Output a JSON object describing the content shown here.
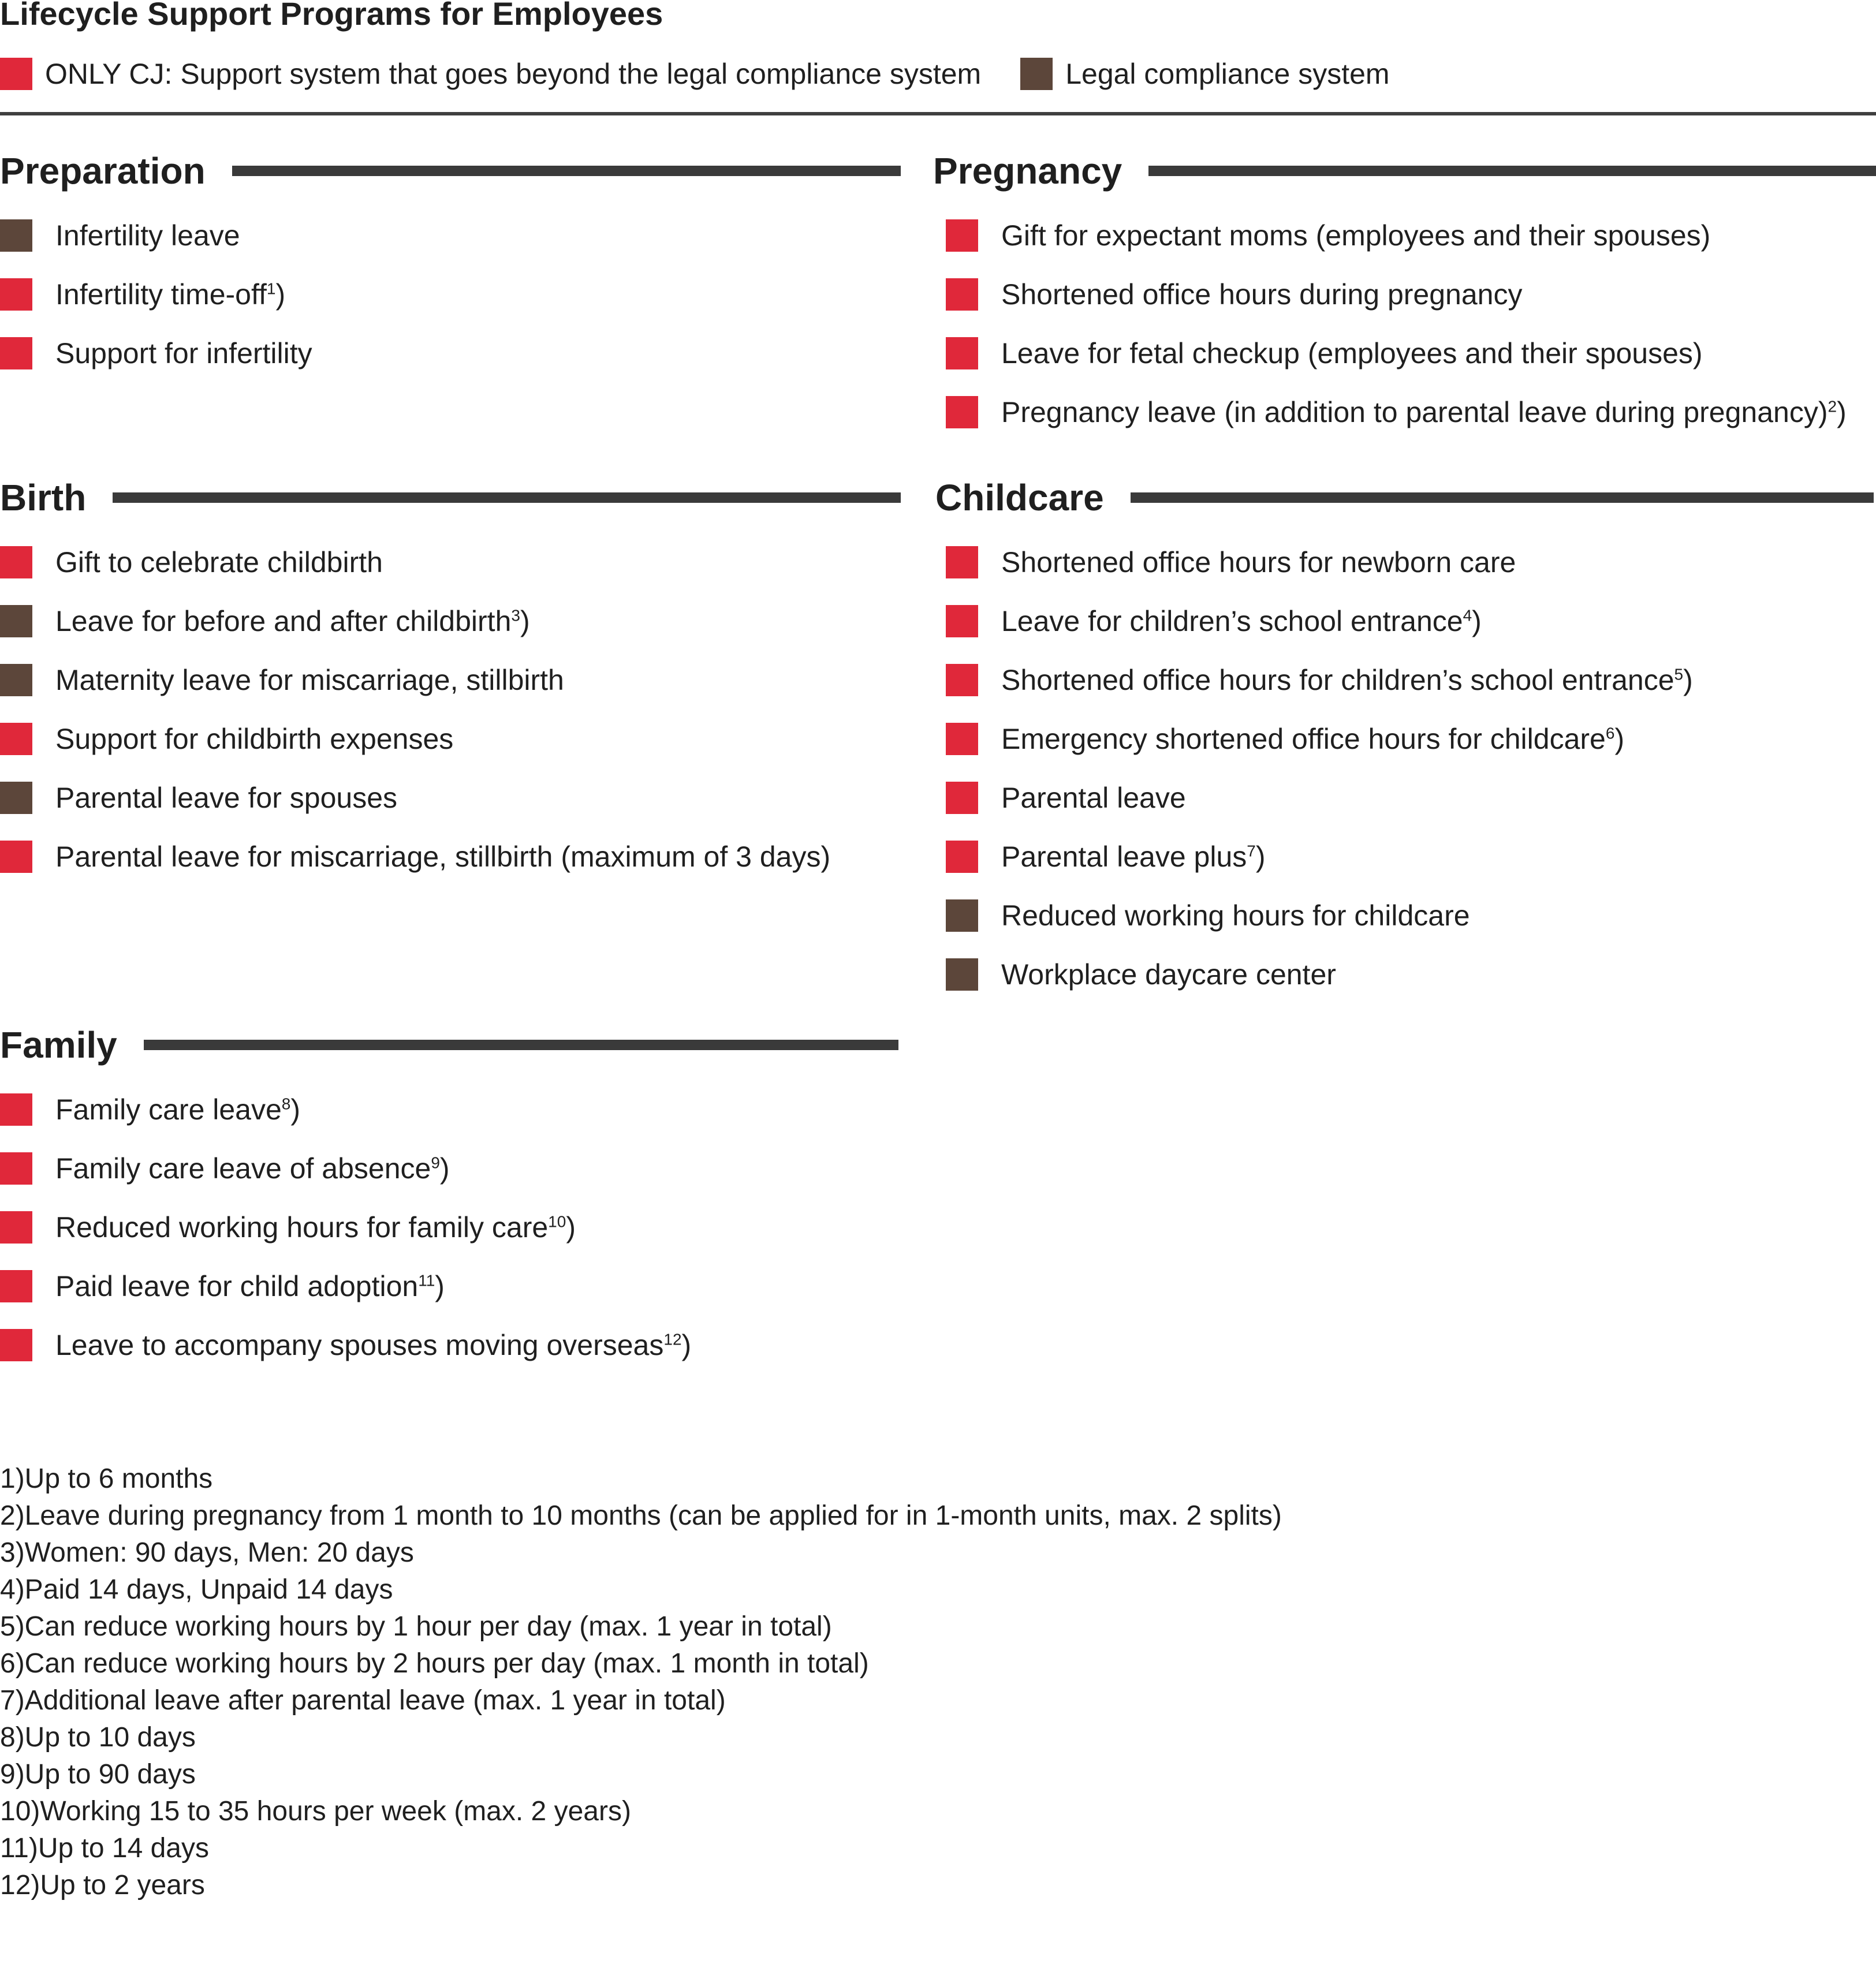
{
  "title": "Lifecycle Support Programs for Employees",
  "colors": {
    "only_cj": "#e0283a",
    "legal": "#5c463a",
    "bar": "#3a3a3a"
  },
  "legend": [
    {
      "type": "only_cj",
      "label": "ONLY CJ: Support system that goes beyond the legal compliance system"
    },
    {
      "type": "legal",
      "label": "Legal compliance system"
    }
  ],
  "sections": {
    "preparation": {
      "title": "Preparation",
      "items": [
        {
          "type": "legal",
          "label": "Infertility leave",
          "note": ""
        },
        {
          "type": "only_cj",
          "label": "Infertility time-off",
          "note": "1"
        },
        {
          "type": "only_cj",
          "label": "Support for infertility",
          "note": ""
        }
      ]
    },
    "pregnancy": {
      "title": "Pregnancy",
      "items": [
        {
          "type": "only_cj",
          "label": "Gift for expectant moms (employees and their spouses)",
          "note": ""
        },
        {
          "type": "only_cj",
          "label": "Shortened office hours during pregnancy",
          "note": ""
        },
        {
          "type": "only_cj",
          "label": "Leave for fetal checkup (employees and their spouses)",
          "note": ""
        },
        {
          "type": "only_cj",
          "label": "Pregnancy leave (in addition to parental leave during pregnancy)",
          "note": "2"
        }
      ]
    },
    "birth": {
      "title": "Birth",
      "items": [
        {
          "type": "only_cj",
          "label": "Gift to celebrate childbirth",
          "note": ""
        },
        {
          "type": "legal",
          "label": "Leave for before and after childbirth",
          "note": "3"
        },
        {
          "type": "legal",
          "label": "Maternity leave for miscarriage, stillbirth",
          "note": ""
        },
        {
          "type": "only_cj",
          "label": "Support for childbirth expenses",
          "note": ""
        },
        {
          "type": "legal",
          "label": "Parental leave for spouses",
          "note": ""
        },
        {
          "type": "only_cj",
          "label": "Parental leave for miscarriage, stillbirth (maximum of 3 days)",
          "note": ""
        }
      ]
    },
    "childcare": {
      "title": "Childcare",
      "items": [
        {
          "type": "only_cj",
          "label": "Shortened office hours for newborn care",
          "note": ""
        },
        {
          "type": "only_cj",
          "label": "Leave for children’s school entrance",
          "note": "4"
        },
        {
          "type": "only_cj",
          "label": "Shortened office hours for children’s school entrance",
          "note": "5"
        },
        {
          "type": "only_cj",
          "label": "Emergency shortened office hours for childcare",
          "note": "6"
        },
        {
          "type": "only_cj",
          "label": "Parental leave",
          "note": ""
        },
        {
          "type": "only_cj",
          "label": "Parental leave plus",
          "note": "7"
        },
        {
          "type": "legal",
          "label": "Reduced working hours for childcare",
          "note": ""
        },
        {
          "type": "legal",
          "label": "Workplace daycare center",
          "note": ""
        }
      ]
    },
    "family": {
      "title": "Family",
      "items": [
        {
          "type": "only_cj",
          "label": "Family care leave",
          "note": "8"
        },
        {
          "type": "only_cj",
          "label": "Family care leave of absence",
          "note": "9"
        },
        {
          "type": "only_cj",
          "label": "Reduced working hours for family care",
          "note": "10"
        },
        {
          "type": "only_cj",
          "label": "Paid leave for child adoption",
          "note": "11"
        },
        {
          "type": "only_cj",
          "label": "Leave to accompany spouses moving overseas",
          "note": "12"
        }
      ]
    }
  },
  "footnotes": [
    "1)Up to 6 months",
    "2)Leave during pregnancy from 1 month to 10 months (can be applied for in 1-month units, max. 2 splits)",
    "3)Women: 90 days, Men: 20 days",
    "4)Paid 14 days, Unpaid 14 days",
    "5)Can reduce working hours by 1 hour per day (max. 1 year in total)",
    "6)Can reduce working hours by 2 hours per day (max. 1 month in total)",
    "7)Additional leave after parental leave (max. 1 year in total)",
    "8)Up to 10 days",
    "9)Up to 90 days",
    "10)Working 15 to 35 hours per week (max. 2 years)",
    "11)Up to 14 days",
    "12)Up to 2 years"
  ]
}
